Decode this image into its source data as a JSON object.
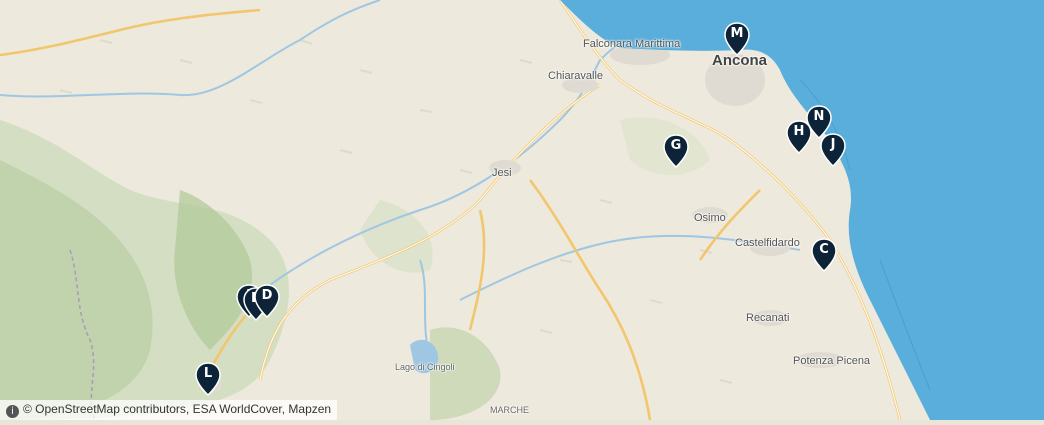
{
  "map": {
    "places": [
      {
        "id": "falconara",
        "name": "Falconara Marittima"
      },
      {
        "id": "ancona",
        "name": "Ancona"
      },
      {
        "id": "chiaravalle",
        "name": "Chiaravalle"
      },
      {
        "id": "jesi",
        "name": "Jesi"
      },
      {
        "id": "osimo",
        "name": "Osimo"
      },
      {
        "id": "castelfidardo",
        "name": "Castelfidardo"
      },
      {
        "id": "recanati",
        "name": "Recanati"
      },
      {
        "id": "potenza",
        "name": "Potenza Picena"
      },
      {
        "id": "cingoli",
        "name": "Lago di Cingoli"
      },
      {
        "id": "marche",
        "name": "MARCHE"
      }
    ],
    "markers": [
      {
        "letter": "M"
      },
      {
        "letter": "G"
      },
      {
        "letter": "H"
      },
      {
        "letter": "N"
      },
      {
        "letter": "J"
      },
      {
        "letter": "C"
      },
      {
        "letter": "A"
      },
      {
        "letter": "B"
      },
      {
        "letter": "D"
      },
      {
        "letter": "L"
      }
    ],
    "colors": {
      "sea": "#5aaedb",
      "land": "#ede9dc",
      "marker": "#0d2438"
    }
  },
  "attribution": {
    "info_icon": "i",
    "text": "© OpenStreetMap contributors, ESA WorldCover, Mapzen"
  }
}
